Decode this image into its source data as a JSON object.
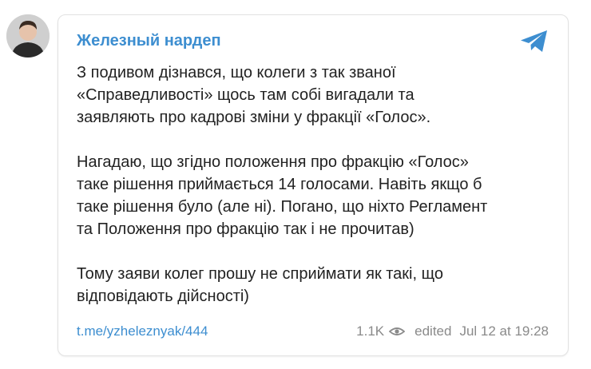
{
  "post": {
    "channel_name": "Железный нардеп",
    "avatar_icon": "avatar-photo",
    "telegram_icon": "telegram-logo-icon",
    "paragraphs": [
      [
        "З подивом дізнався, що колеги з так званої",
        "«Справедливості» щось там собі вигадали та",
        "заявляють про кадрові зміни у фракції «Голос»."
      ],
      [
        "Нагадаю, що згідно положення про фракцію «Голос»",
        "таке рішення приймається 14 голосами. Навіть якщо б",
        "таке рішення було (але ні). Погано, що ніхто Регламент",
        "та Положення про фракцію так і не прочитав)"
      ],
      [
        "Тому заяви колег прошу не сприймати як такі, що",
        "відповідають дійсності)"
      ]
    ],
    "footer": {
      "link_text": "t.me/yzheleznyak/444",
      "views": "1.1K",
      "views_icon": "eye-icon",
      "edited_label": "edited",
      "date": "Jul 12 at 19:28"
    }
  },
  "colors": {
    "accent": "#3d8ed0",
    "text": "#222222",
    "muted": "#8a8a8a",
    "border": "#e2e2e2"
  }
}
